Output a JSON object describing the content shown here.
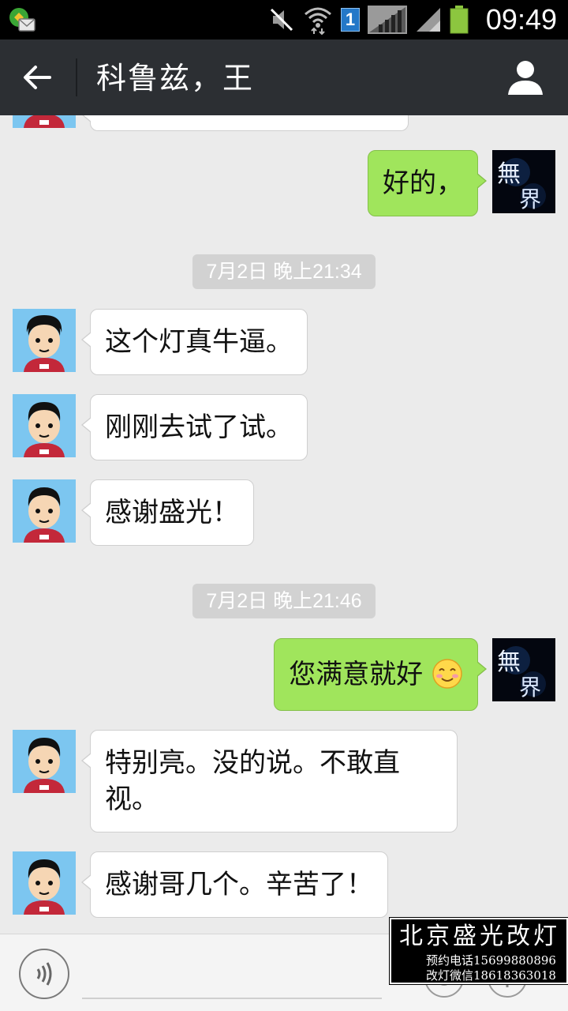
{
  "status_bar": {
    "time": "09:49",
    "sim_label": "1",
    "icons": [
      "app-notification-icon",
      "mute-icon",
      "wifi-icon",
      "sim1-icon",
      "signal-icon",
      "signal-icon",
      "battery-icon"
    ],
    "battery_color": "#8cc63f"
  },
  "header": {
    "title": "科鲁兹，王",
    "back_icon": "back-arrow-icon",
    "profile_icon": "user-profile-icon"
  },
  "chat": {
    "messages": [
      {
        "type": "outgoing",
        "text": "好的，",
        "avatar_text": "無界"
      },
      {
        "type": "timestamp",
        "text": "7月2日 晚上21:34"
      },
      {
        "type": "incoming",
        "text": "这个灯真牛逼。"
      },
      {
        "type": "incoming",
        "text": "刚刚去试了试。"
      },
      {
        "type": "incoming",
        "text": "感谢盛光！"
      },
      {
        "type": "timestamp",
        "text": "7月2日 晚上21:46"
      },
      {
        "type": "outgoing",
        "text": "您满意就好",
        "emoji": "smile-emoji-icon",
        "avatar_text": "無界"
      },
      {
        "type": "incoming",
        "text": "特别亮。没的说。不敢直视。"
      },
      {
        "type": "incoming",
        "text": "感谢哥几个。辛苦了！"
      }
    ],
    "colors": {
      "background": "#ebebeb",
      "outgoing_bubble": "#a0e55c",
      "incoming_bubble": "#ffffff",
      "timestamp_bg": "#d2d2d2"
    }
  },
  "input_bar": {
    "voice_icon": "voice-input-icon",
    "emoji_icon": "emoji-icon",
    "more_icon": "plus-icon"
  },
  "watermark": {
    "title": "北京盛光改灯",
    "line1": "预约电话15699880896",
    "line2": "改灯微信18618363018"
  }
}
